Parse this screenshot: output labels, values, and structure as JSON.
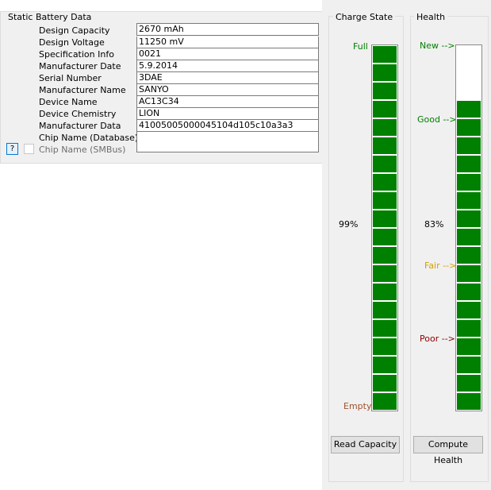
{
  "static": {
    "title": "Static Battery Data",
    "fields": [
      {
        "label": "Design Capacity",
        "value": "2670 mAh"
      },
      {
        "label": "Design Voltage",
        "value": "11250 mV"
      },
      {
        "label": "Specification Info",
        "value": "0021"
      },
      {
        "label": "Manufacturer Date",
        "value": "5.9.2014"
      },
      {
        "label": "Serial Number",
        "value": "3DAE"
      },
      {
        "label": "Manufacturer Name",
        "value": "SANYO"
      },
      {
        "label": "Device Name",
        "value": "AC13C34"
      },
      {
        "label": "Device Chemistry",
        "value": "LION"
      },
      {
        "label": "Manufacturer Data",
        "value": "41005005000045104d105c10a3a3"
      },
      {
        "label": "Chip Name (Database)",
        "value": ""
      }
    ],
    "help_button": "?",
    "smbus_label": "Chip Name (SMBus)"
  },
  "charge": {
    "title": "Charge State",
    "full_label": "Full",
    "empty_label": "Empty",
    "percent_label": "99%",
    "level": 0.99,
    "button": "Read Capacity"
  },
  "health": {
    "title": "Health",
    "new_label": "New -->",
    "good_label": "Good -->",
    "fair_label": "Fair -->",
    "poor_label": "Poor -->",
    "percent_label": "83%",
    "level": 0.83,
    "button": "Compute Health"
  },
  "colors": {
    "bar_fill": "#008000",
    "full": "#008000",
    "empty": "#a0522d",
    "new": "#008000",
    "good": "#008000",
    "fair": "#d4a000",
    "poor": "#8b0000"
  }
}
